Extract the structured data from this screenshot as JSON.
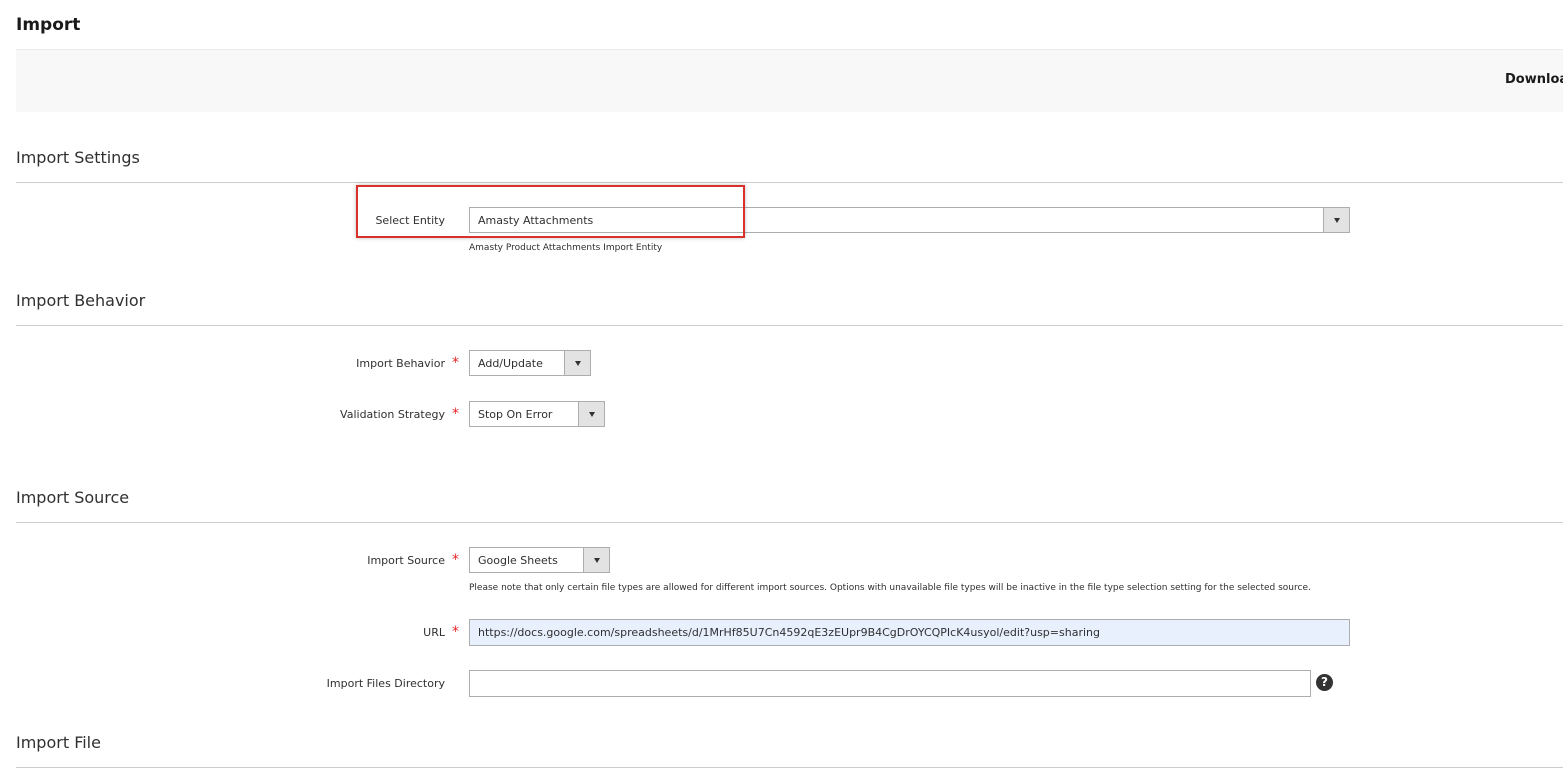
{
  "page": {
    "title": "Import",
    "toolbar_link": "Downloa"
  },
  "sections": {
    "settings": "Import Settings",
    "behavior": "Import Behavior",
    "source": "Import Source",
    "file": "Import File"
  },
  "select_entity": {
    "label": "Select Entity",
    "value": "Amasty Attachments",
    "note": "Amasty Product Attachments Import Entity",
    "highlighted": true
  },
  "import_behavior": {
    "label": "Import Behavior",
    "value": "Add/Update",
    "required": "*"
  },
  "validation_strategy": {
    "label": "Validation Strategy",
    "value": "Stop On Error",
    "required": "*"
  },
  "import_source": {
    "label": "Import Source",
    "value": "Google Sheets",
    "required": "*",
    "note": "Please note that only certain file types are allowed for different import sources. Options with unavailable file types will be inactive in the file type selection setting for the selected source."
  },
  "url": {
    "label": "URL",
    "value": "https://docs.google.com/spreadsheets/d/1MrHf85U7Cn4592qE3zEUpr9B4CgDrOYCQPIcK4usyol/edit?usp=sharing",
    "required": "*"
  },
  "import_files_directory": {
    "label": "Import Files Directory",
    "value": "",
    "help_icon": "?"
  },
  "icons": {
    "dropdown": "chevron-down-icon",
    "help": "question-circle-icon"
  },
  "colors": {
    "required_star": "#e22626",
    "highlight_border": "#d9302c",
    "autofill_bg": "#e8f0fe"
  }
}
